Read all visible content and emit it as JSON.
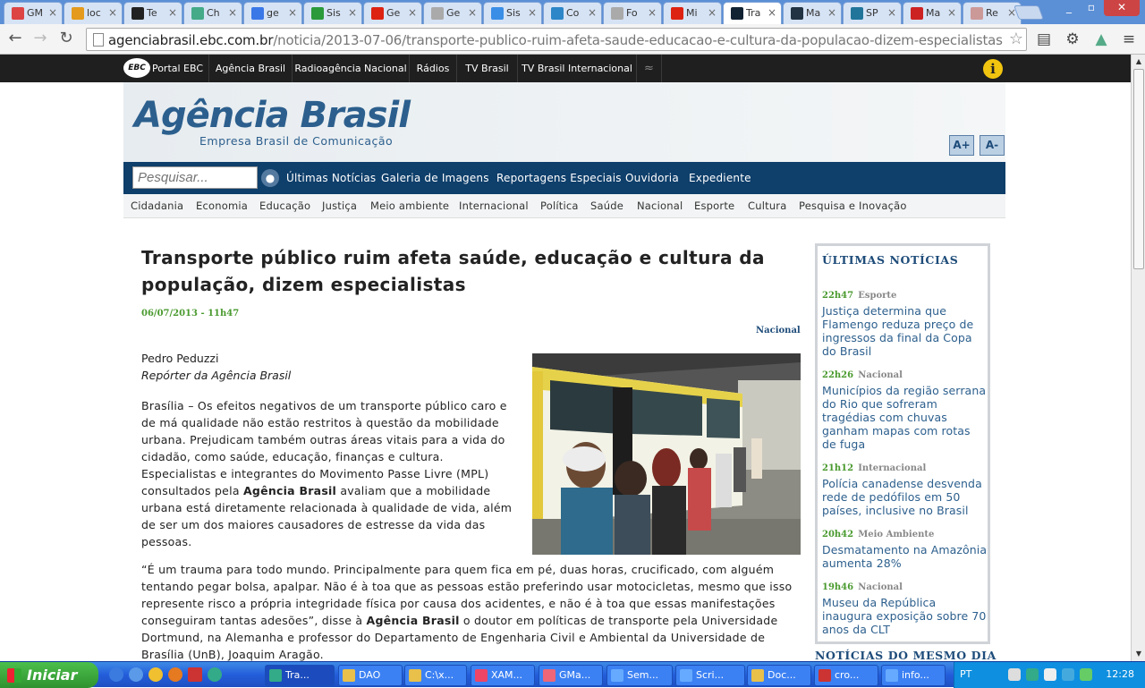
{
  "browser": {
    "tabs": [
      {
        "label": "GM",
        "icon": "gmail-icon",
        "color": "#d44"
      },
      {
        "label": "loc",
        "icon": "pma-icon",
        "color": "#e49a1c"
      },
      {
        "label": "Te",
        "icon": "github-icon",
        "color": "#222"
      },
      {
        "label": "Ch",
        "icon": "chrome-web-icon",
        "color": "#4a8"
      },
      {
        "label": "ge",
        "icon": "google-icon",
        "color": "#3b78e7"
      },
      {
        "label": "Sis",
        "icon": "brazil-flag-icon",
        "color": "#2a9a3a"
      },
      {
        "label": "Ge",
        "icon": "youtube-icon",
        "color": "#d21"
      },
      {
        "label": "Ge",
        "icon": "doc-icon",
        "color": "#aaa"
      },
      {
        "label": "Sis",
        "icon": "cloud-icon",
        "color": "#3a8ee6"
      },
      {
        "label": "Co",
        "icon": "gear-tab-icon",
        "color": "#2d86c8"
      },
      {
        "label": "Fo",
        "icon": "doc-icon",
        "color": "#aaa"
      },
      {
        "label": "Mi",
        "icon": "youtube-icon",
        "color": "#d21"
      },
      {
        "label": "Tra",
        "icon": "ebc-icon",
        "color": "#123"
      },
      {
        "label": "Ma",
        "icon": "c-icon",
        "color": "#234"
      },
      {
        "label": "SP",
        "icon": "wordpress-icon",
        "color": "#21759b"
      },
      {
        "label": "Ma",
        "icon": "red-tab-icon",
        "color": "#c22"
      },
      {
        "label": "Re",
        "icon": "page-icon",
        "color": "#c99"
      }
    ],
    "active_tab": 12,
    "url_domain": "agenciabrasil.ebc.com.br",
    "url_path": "/noticia/2013-07-06/transporte-publico-ruim-afeta-saude-educacao-e-cultura-da-populacao-dizem-especialistas"
  },
  "ebc_bar": {
    "logo_text": "EBC",
    "links": [
      "Portal EBC",
      "Agência Brasil",
      "Radioagência Nacional",
      "Rádios",
      "TV Brasil",
      "TV Brasil Internacional"
    ],
    "info_glyph": "i"
  },
  "header": {
    "brand": "Agência Brasil",
    "tagline": "Empresa Brasil de Comunicação",
    "font_plus": "A+",
    "font_minus": "A-"
  },
  "main_nav": {
    "search_placeholder": "Pesquisar...",
    "links": [
      "Últimas Notícias",
      "Galeria de Imagens",
      "Reportagens Especiais",
      "Ouvidoria",
      "Expediente"
    ]
  },
  "categories": [
    "Cidadania",
    "Economia",
    "Educação",
    "Justiça",
    "Meio ambiente",
    "Internacional",
    "Política",
    "Saúde",
    "Nacional",
    "Esporte",
    "Cultura",
    "Pesquisa e Inovação"
  ],
  "article": {
    "title": "Transporte público ruim afeta saúde, educação e cultura da população, dizem especialistas",
    "date": "06/07/2013 - 11h47",
    "section": "Nacional",
    "author": "Pedro Peduzzi",
    "role": "Repórter da Agência Brasil",
    "p1_a": "Brasília – Os efeitos negativos de um transporte público caro e de má qualidade não estão restritos à questão da mobilidade urbana. Prejudicam também outras áreas vitais para a vida do cidadão, como saúde, educação, finanças e cultura. Especialistas e integrantes do Movimento Passe Livre (MPL) consultados pela ",
    "p1_bold": "Agência Brasil",
    "p1_b": " avaliam que a mobilidade urbana está diretamente relacionada à qualidade de vida, além de ser um dos maiores causadores de estresse da vida das pessoas.",
    "p2_a": "“É um trauma para todo mundo. Principalmente para quem fica em pé, duas horas, crucificado, com alguém tentando pegar bolsa, apalpar. Não é à toa que as pessoas estão preferindo usar motocicletas, mesmo que isso represente risco a própria integridade física por causa dos acidentes, e não é à toa que essas manifestações conseguiram tantas adesões”, disse à ",
    "p2_bold": "Agência Brasil",
    "p2_b": " o doutor em políticas de transporte pela Universidade Dortmund, na Alemanha e professor do Departamento de Engenharia Civil e Ambiental da Universidade de Brasília (UnB), Joaquim Aragão."
  },
  "sidebar": {
    "title": "ÚLTIMAS NOTÍCIAS",
    "items": [
      {
        "time": "22h47",
        "category": "Esporte",
        "headline": "Justiça determina que Flamengo reduza preço de ingressos da final da Copa do Brasil"
      },
      {
        "time": "22h26",
        "category": "Nacional",
        "headline": "Municípios da região serrana do Rio que sofreram tragédias com chuvas ganham mapas com rotas de fuga"
      },
      {
        "time": "21h12",
        "category": "Internacional",
        "headline": "Polícia canadense desvenda rede de pedófilos em 50 países, inclusive no Brasil"
      },
      {
        "time": "20h42",
        "category": "Meio Ambiente",
        "headline": "Desmatamento na Amazônia aumenta 28%"
      },
      {
        "time": "19h46",
        "category": "Nacional",
        "headline": "Museu da República inaugura exposição sobre 70 anos da CLT"
      }
    ],
    "next_section": "NOTÍCIAS DO MESMO DIA"
  },
  "taskbar": {
    "start_label": "Iniciar",
    "tasks": [
      {
        "label": "Tra...",
        "color": "#3a8"
      },
      {
        "label": "DAO",
        "color": "#e8c04a"
      },
      {
        "label": "C:\\x...",
        "color": "#e8c04a"
      },
      {
        "label": "XAM...",
        "color": "#e46"
      },
      {
        "label": "GMa...",
        "color": "#e67"
      },
      {
        "label": "Sem...",
        "color": "#6af"
      },
      {
        "label": "Scri...",
        "color": "#6af"
      },
      {
        "label": "Doc...",
        "color": "#e8c04a"
      },
      {
        "label": "cro...",
        "color": "#c33"
      },
      {
        "label": "info...",
        "color": "#6af"
      }
    ],
    "lang": "PT",
    "clock": "12:28"
  }
}
